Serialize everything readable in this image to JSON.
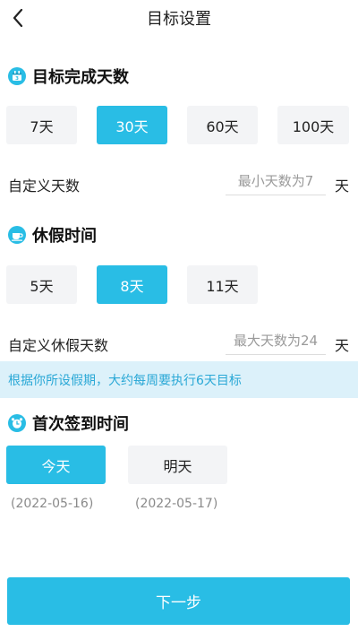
{
  "header": {
    "title": "目标设置"
  },
  "target_days": {
    "heading": "目标完成天数",
    "options": [
      "7天",
      "30天",
      "60天",
      "100天"
    ],
    "selected_index": 1,
    "custom_label": "自定义天数",
    "custom_placeholder": "最小天数为7",
    "unit": "天"
  },
  "vacation": {
    "heading": "休假时间",
    "options": [
      "5天",
      "8天",
      "11天"
    ],
    "selected_index": 1,
    "custom_label": "自定义休假天数",
    "custom_placeholder": "最大天数为24",
    "unit": "天"
  },
  "banner": {
    "text": "根据你所设假期，大约每周要执行6天目标"
  },
  "first_checkin": {
    "heading": "首次签到时间",
    "options": [
      {
        "label": "今天",
        "date": "(2022-05-16)"
      },
      {
        "label": "明天",
        "date": "(2022-05-17)"
      }
    ],
    "selected_index": 0
  },
  "footer": {
    "next_label": "下一步"
  },
  "colors": {
    "accent": "#29bde5",
    "chip_bg": "#f3f4f6",
    "banner_bg": "#dcf1fa",
    "banner_text": "#2aa8d6"
  },
  "icons": {
    "back": "chevron-left-icon",
    "target": "calendar-icon",
    "vacation": "coffee-cup-icon",
    "checkin": "alarm-clock-icon"
  }
}
